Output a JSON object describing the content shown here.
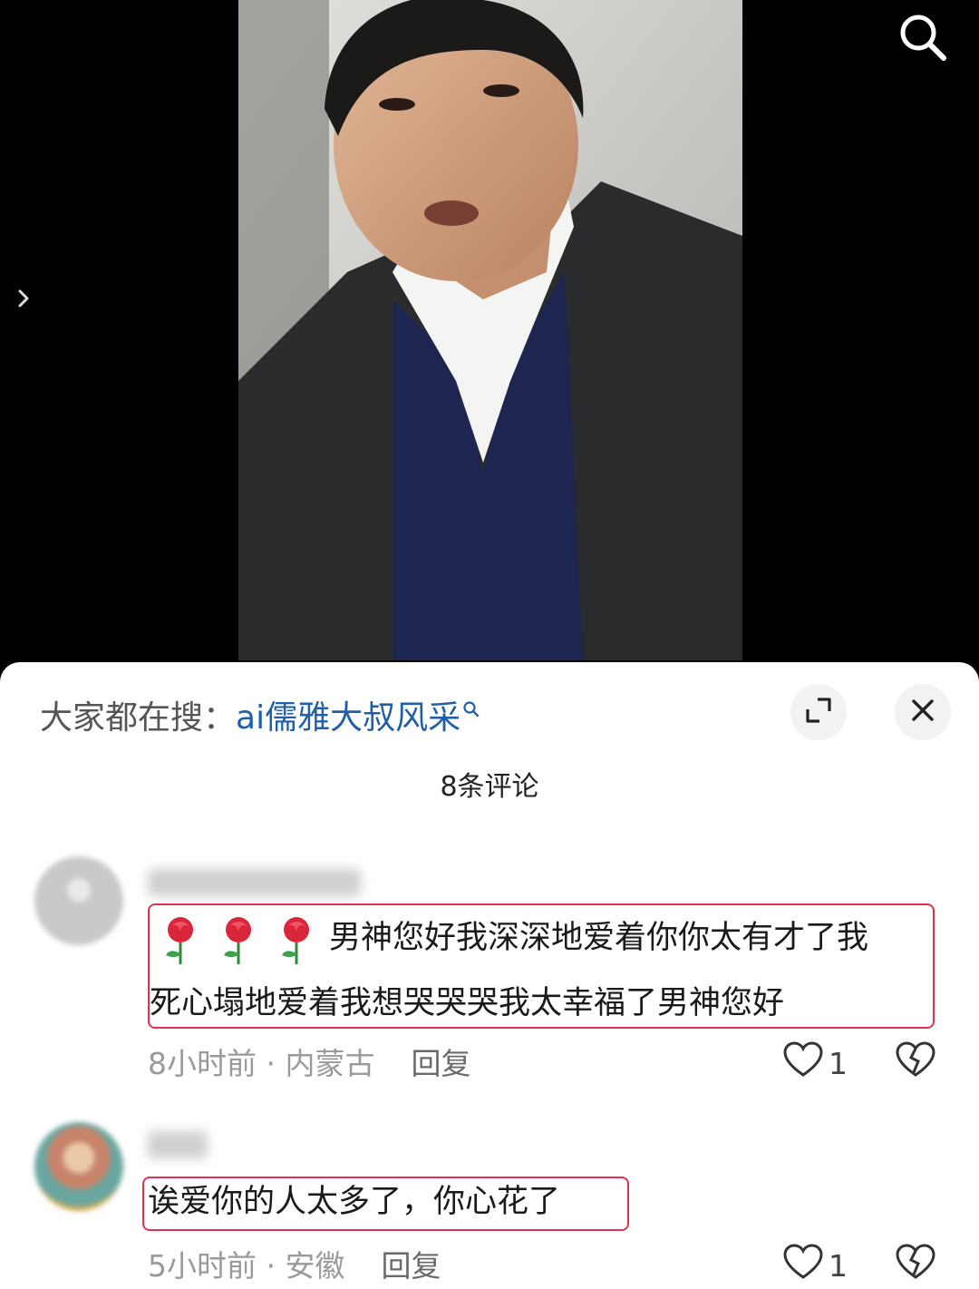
{
  "video": {
    "search_icon": "search-icon",
    "side_arrow_icon": "chevron-right-icon"
  },
  "sheet": {
    "hot_search_label": "大家都在搜：",
    "hot_search_keyword": "ai儒雅大叔风采",
    "expand_icon": "expand-icon",
    "close_icon": "close-icon",
    "comment_count": "8条评论"
  },
  "comments": [
    {
      "emoji": "rose-emoji",
      "line1": "男神您好我深深地爱着你你太有才了我",
      "line2": "死心塌地爱着我想哭哭哭我太幸福了男神您好",
      "time": "8小时前",
      "location": "内蒙古",
      "reply_label": "回复",
      "likes": "1"
    },
    {
      "line1": "诶爱你的人太多了，你心花了",
      "time": "5小时前",
      "location": "安徽",
      "reply_label": "回复",
      "likes": "1"
    }
  ],
  "colors": {
    "keyword": "#1f5fa8",
    "highlight_box": "#e0324a"
  }
}
